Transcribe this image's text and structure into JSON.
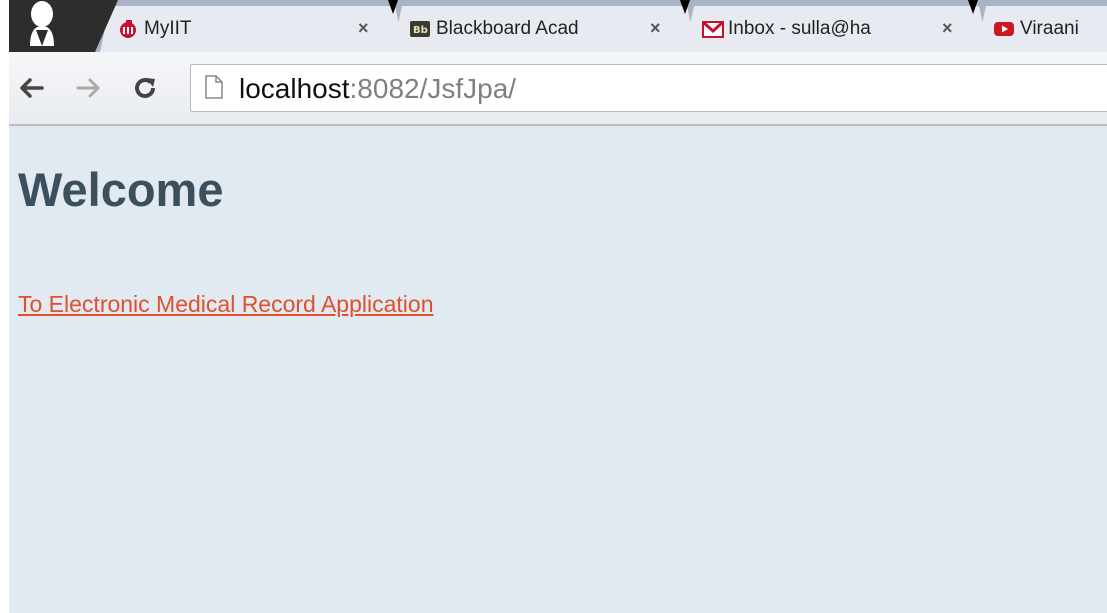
{
  "browser": {
    "tabs": [
      {
        "title": "MyIIT",
        "favicon": "myiit-icon",
        "close": "×"
      },
      {
        "title": "Blackboard Acad",
        "favicon": "blackboard-icon",
        "close": "×"
      },
      {
        "title": "Inbox - sulla@ha",
        "favicon": "gmail-icon",
        "close": "×"
      },
      {
        "title": "Viraani",
        "favicon": "youtube-icon"
      }
    ],
    "toolbar": {
      "back_icon": "back-arrow-icon",
      "forward_icon": "forward-arrow-icon",
      "reload_icon": "reload-icon"
    },
    "url": {
      "host": "localhost",
      "rest": ":8082/JsfJpa/"
    }
  },
  "page": {
    "heading": "Welcome",
    "link_text": "To Electronic Medical Record Application"
  },
  "colors": {
    "page_background": "#e0eaf0",
    "heading": "#3c4f5c",
    "link": "#e0502f"
  }
}
